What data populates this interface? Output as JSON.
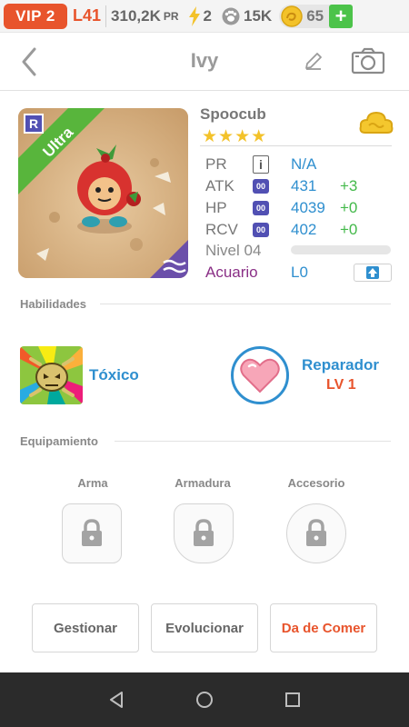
{
  "status_bar": {
    "vip": "VIP 2",
    "level": "L41",
    "pr_value": "310,2K",
    "pr_suffix": "PR",
    "energy": "2",
    "paws": "15K",
    "coins": "65",
    "add_label": "+"
  },
  "header": {
    "title": "Ivy"
  },
  "pet": {
    "rarity": "Ultra",
    "rarity_badge": "R",
    "name": "Spoocub",
    "stars": "★★★★",
    "star_count": 4,
    "stats": [
      {
        "label": "PR",
        "value": "N/A",
        "bonus": "",
        "badge": "i"
      },
      {
        "label": "ATK",
        "value": "431",
        "bonus": "+3",
        "badge": "00"
      },
      {
        "label": "HP",
        "value": "4039",
        "bonus": "+0",
        "badge": "00"
      },
      {
        "label": "RCV",
        "value": "402",
        "bonus": "+0",
        "badge": "00"
      }
    ],
    "nivel": "Nivel 04",
    "xp_fraction": 0.0,
    "acuario_label": "Acuario",
    "acuario_level": "L0"
  },
  "skills": {
    "section_title": "Habilidades",
    "active_name": "Tóxico",
    "passive_name": "Reparador",
    "passive_level": "LV 1"
  },
  "equipment": {
    "section_title": "Equipamiento",
    "slots": [
      "Arma",
      "Armadura",
      "Accesorio"
    ]
  },
  "actions": {
    "manage": "Gestionar",
    "evolve": "Evolucionar",
    "feed": "Da de Comer"
  },
  "colors": {
    "accent_orange": "#e8542c",
    "blue": "#2f8fcf",
    "green": "#43b94a",
    "purple": "#8a2f86",
    "badge": "#5150b3"
  }
}
